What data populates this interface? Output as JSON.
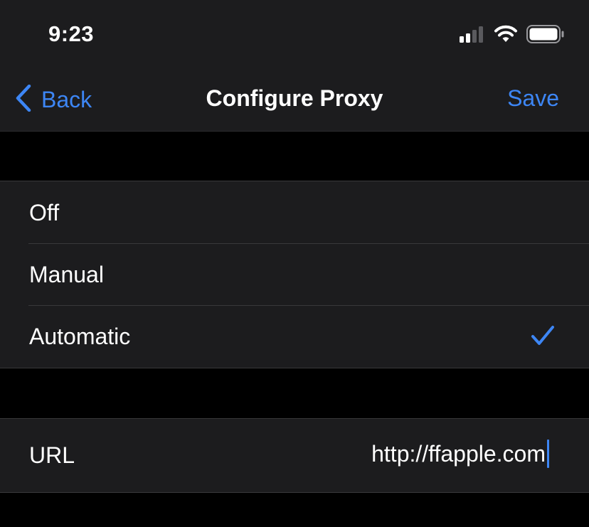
{
  "status_bar": {
    "time": "9:23",
    "signal_icon": "cellular-signal-icon",
    "wifi_icon": "wifi-icon",
    "battery_icon": "battery-icon"
  },
  "navbar": {
    "back_label": "Back",
    "title": "Configure Proxy",
    "save_label": "Save"
  },
  "proxy_modes": {
    "items": [
      {
        "label": "Off",
        "selected": false
      },
      {
        "label": "Manual",
        "selected": false
      },
      {
        "label": "Automatic",
        "selected": true
      }
    ]
  },
  "url_setting": {
    "label": "URL",
    "value": "http://ffapple.com"
  },
  "colors": {
    "accent": "#3d86f5",
    "background": "#000000",
    "cell": "#1c1c1e",
    "separator": "#38383a"
  }
}
